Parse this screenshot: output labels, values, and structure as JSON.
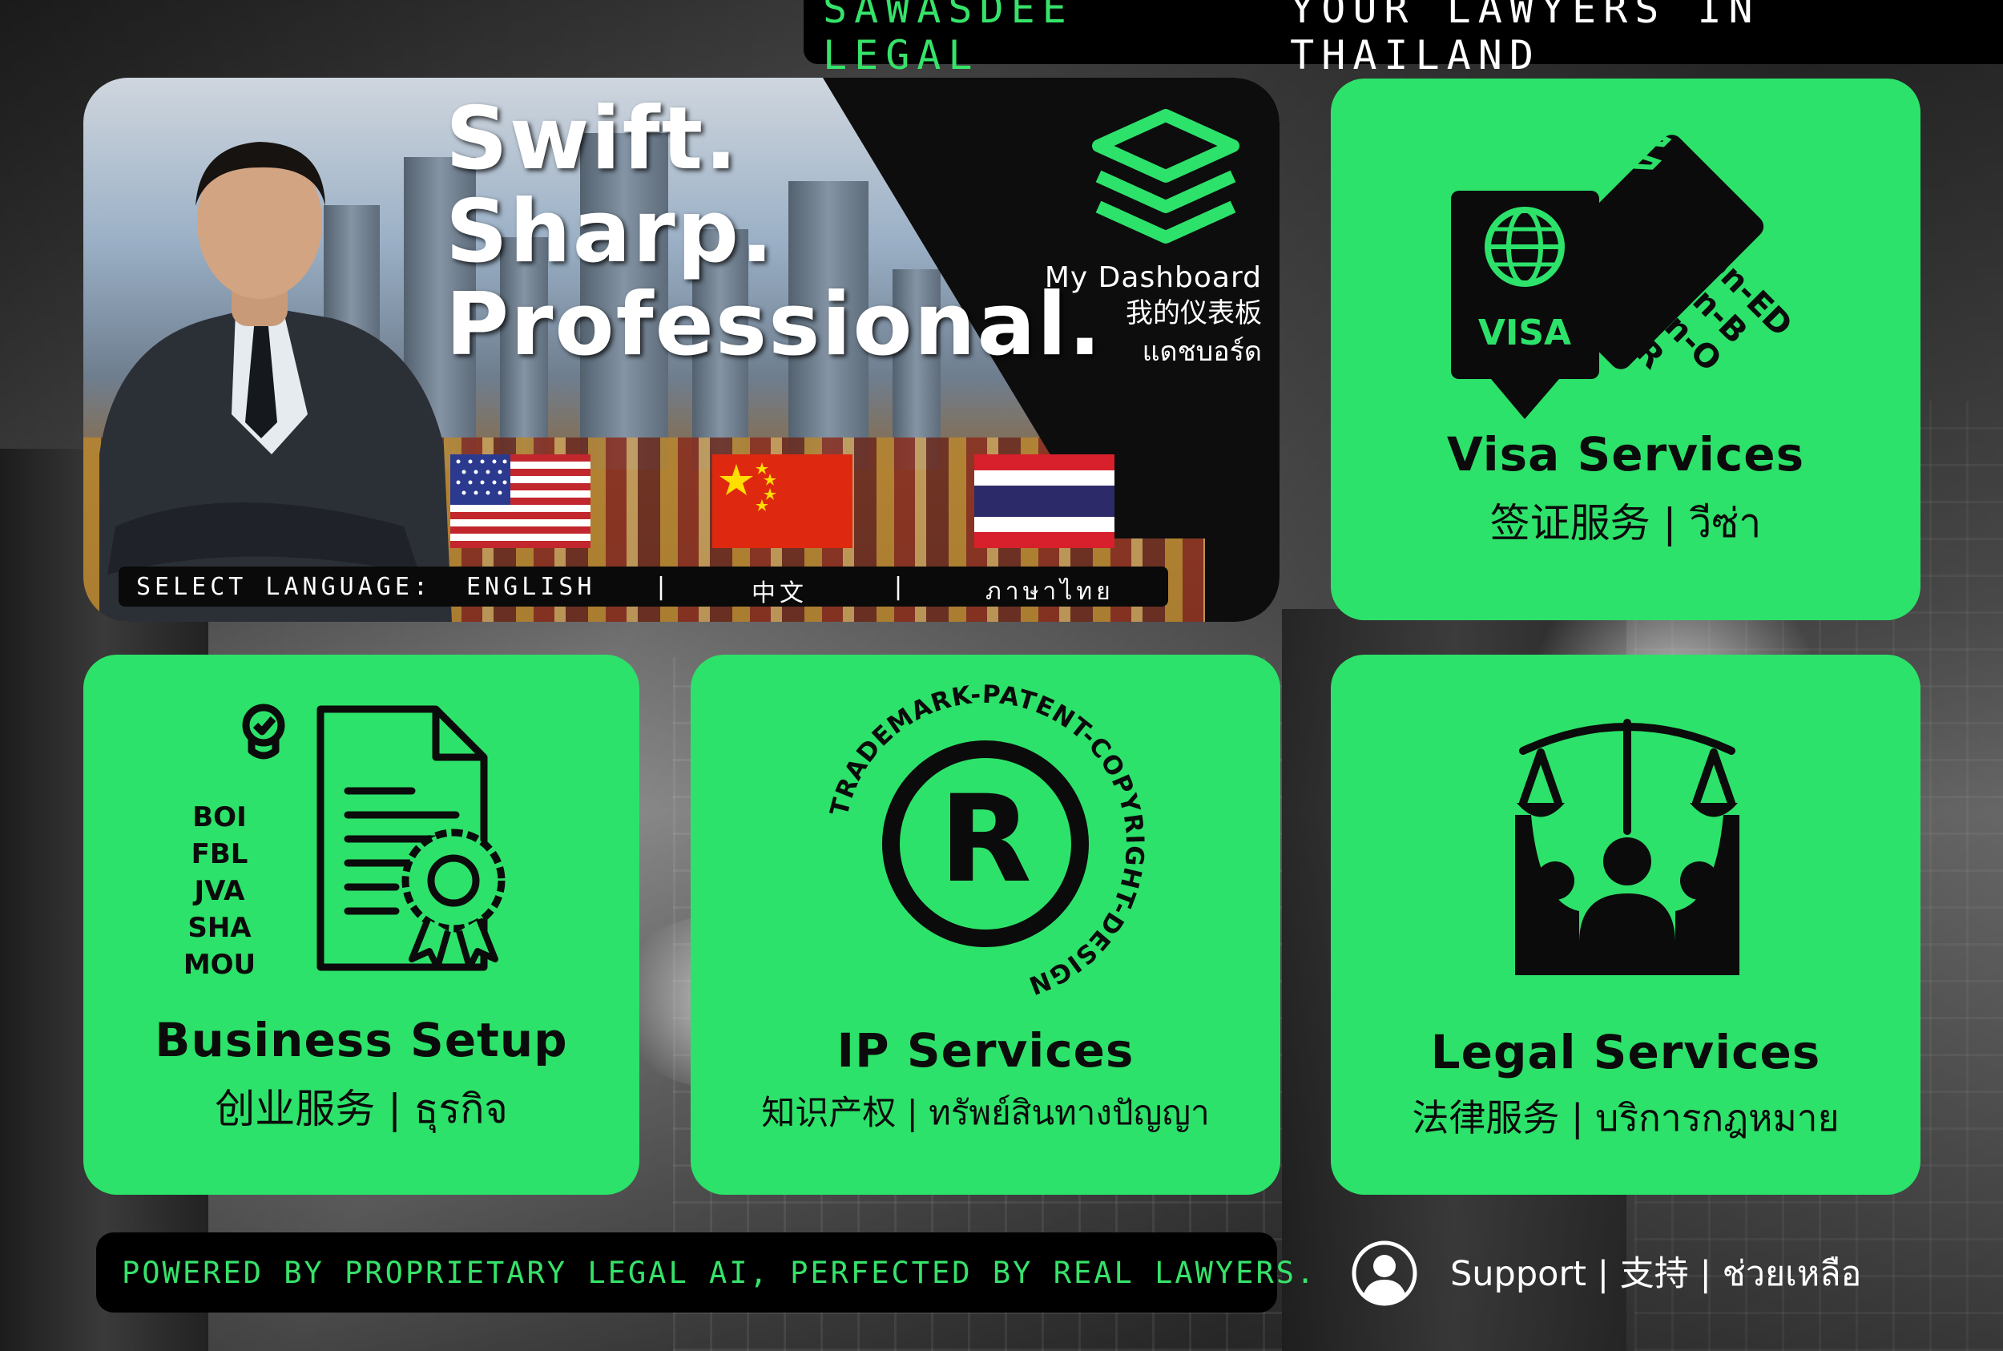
{
  "brand": {
    "name": "SAWASDEE LEGAL",
    "tagline": "YOUR LAWYERS IN THAILAND"
  },
  "hero": {
    "lines": [
      "Swift.",
      "Sharp.",
      "Professional."
    ],
    "dashboard": {
      "en": "My Dashboard",
      "zh": "我的仪表板",
      "th": "แดชบอร์ด"
    },
    "language": {
      "label": "SELECT LANGUAGE:",
      "options": [
        "ENGLISH",
        "中文",
        "ภาษาไทย"
      ],
      "separator": "|"
    }
  },
  "cards": {
    "visa": {
      "title": "Visa Services",
      "subtitle": "签证服务 | วีซ่า",
      "badge": "VISA",
      "types": [
        "non-ED",
        "non-B",
        "non-O",
        "LTR"
      ]
    },
    "business": {
      "title": "Business Setup",
      "subtitle": "创业服务 | ธุรกิจ",
      "items": [
        "BOI",
        "FBL",
        "JVA",
        "SHA",
        "MOU"
      ]
    },
    "ip": {
      "title": "IP Services",
      "subtitle": "知识产权 | ทรัพย์สินทางปัญญา",
      "ring_text": "TRADEMARK-PATENT-COPYRIGHT-DESIGN",
      "mark": "R"
    },
    "legal": {
      "title": "Legal Services",
      "subtitle": "法律服务 | บริการกฎหมาย"
    }
  },
  "footer": {
    "slogan": "POWERED BY PROPRIETARY LEGAL AI, PERFECTED BY REAL LAWYERS.",
    "support": "Support | 支持 | ช่วยเหลือ"
  },
  "icons": {
    "dashboard": "layers-icon",
    "visa": "passport-icon",
    "business": "document-certificate-icon",
    "ip": "registered-trademark-icon",
    "legal": "scales-justice-people-icon",
    "support": "user-avatar-icon",
    "flags": [
      "us-flag-icon",
      "china-flag-icon",
      "thailand-flag-icon"
    ]
  },
  "colors": {
    "accent": "#2de26a",
    "accent_text": "#36e36a",
    "dark": "#000000"
  }
}
